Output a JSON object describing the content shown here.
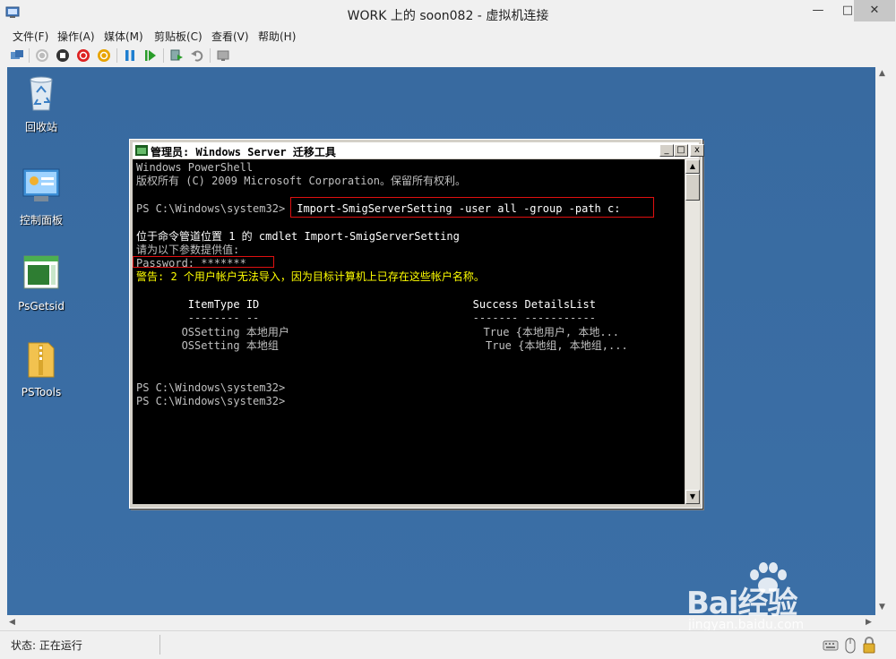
{
  "window": {
    "title": "WORK 上的 soon082 - 虚拟机连接",
    "min_label": "—",
    "max_label": "□",
    "close_label": "✕"
  },
  "menubar": {
    "items": [
      "文件(F)",
      "操作(A)",
      "媒体(M)",
      "剪贴板(C)",
      "查看(V)",
      "帮助(H)"
    ]
  },
  "toolbar": {
    "icons": [
      "ctrl-alt-del-icon",
      "start-icon",
      "turn-off-icon",
      "shutdown-icon",
      "save-icon",
      "pause-icon",
      "reset-icon",
      "snapshot-icon",
      "revert-icon",
      "enhanced-session-icon"
    ]
  },
  "desktop": {
    "icons": [
      {
        "label": "回收站",
        "icon": "recycle-bin-icon"
      },
      {
        "label": "控制面板",
        "icon": "control-panel-icon"
      },
      {
        "label": "PsGetsid",
        "icon": "app-window-icon"
      },
      {
        "label": "PSTools",
        "icon": "folder-icon"
      }
    ]
  },
  "console": {
    "title": "管理员: Windows Server 迁移工具",
    "min_label": "_",
    "max_label": "□",
    "close_label": "x",
    "lines": {
      "l1": "Windows PowerShell",
      "l2": "版权所有 (C) 2009 Microsoft Corporation。保留所有权利。",
      "l3_prompt": "PS C:\\Windows\\system32>",
      "l3_cmd": " Import-SmigServerSetting -user all -group -path c:",
      "l4": "位于命令管道位置 1 的 cmdlet Import-SmigServerSetting",
      "l5": "请为以下参数提供值:",
      "l6": "Password: *******",
      "l7": "警告: 2 个用户帐户无法导入，因为目标计算机上已存在这些帐户名称。",
      "h1": "        ItemType ID                                 Success DetailsList",
      "h2": "        -------- --                                 ------- -----------",
      "r1": "       OSSetting 本地用户                              True {本地用户, 本地...",
      "r2": "       OSSetting 本地组                                True {本地组, 本地组,...",
      "p1": "PS C:\\Windows\\system32>",
      "p2": "PS C:\\Windows\\system32>"
    }
  },
  "statusbar": {
    "text": "状态: 正在运行"
  },
  "watermark": {
    "brand": "Bai经验",
    "site": "jingyan.baidu.com"
  },
  "colors": {
    "desktop": "#3a6ea5",
    "console_bg": "#000000",
    "warning_text": "#ffff00",
    "highlight_box": "#e01010"
  }
}
